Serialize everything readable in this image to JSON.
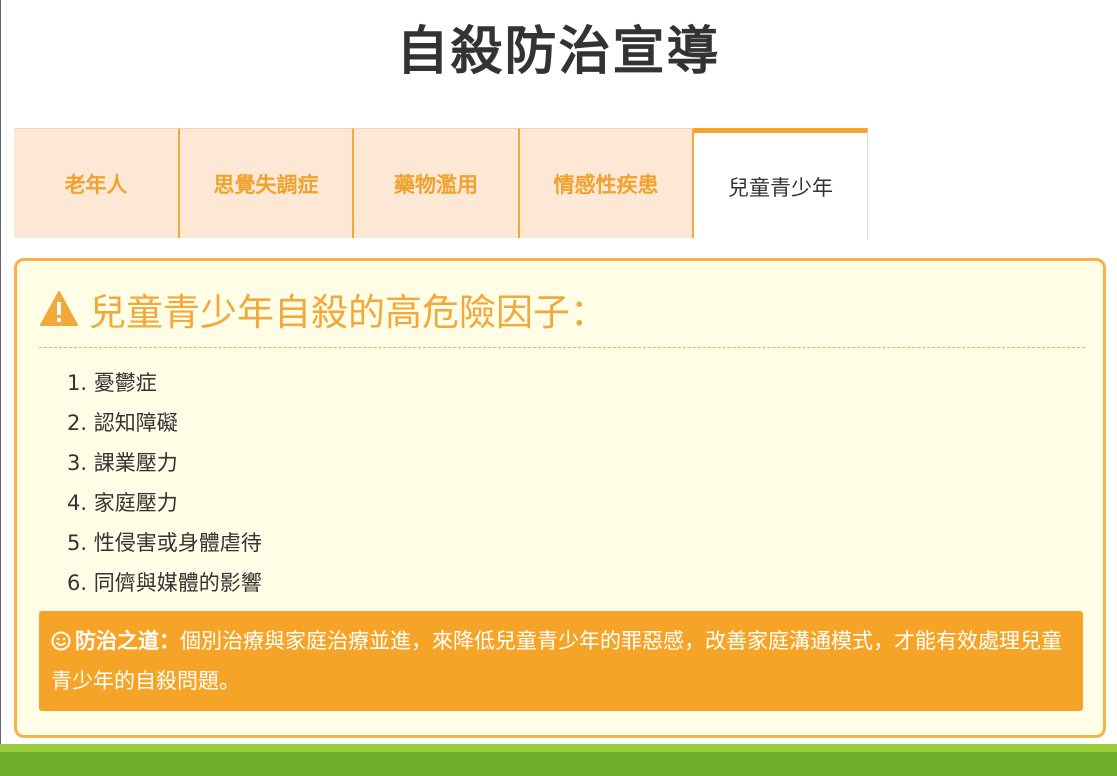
{
  "page": {
    "title": "自殺防治宣導"
  },
  "tabs": [
    {
      "label": "老年人",
      "active": false
    },
    {
      "label": "思覺失調症",
      "active": false
    },
    {
      "label": "藥物濫用",
      "active": false
    },
    {
      "label": "情感性疾患",
      "active": false
    },
    {
      "label": "兒童青少年",
      "active": true
    }
  ],
  "panel": {
    "icon": "warning-triangle-icon",
    "heading": "兒童青少年自殺的高危險因子：",
    "risk_factors": [
      "1. 憂鬱症",
      "2. 認知障礙",
      "3. 課業壓力",
      "4. 家庭壓力",
      "5. 性侵害或身體虐待",
      "6. 同儕與媒體的影響"
    ],
    "tip": {
      "icon": "smile-icon",
      "label": "防治之道：",
      "text": "個別治療與家庭治療並進，來降低兒童青少年的罪惡感，改善家庭溝通模式，才能有效處理兒童青少年的自殺問題。"
    }
  },
  "colors": {
    "accent": "#f6a428",
    "tab_bg": "#fde8d5",
    "panel_bg": "#fffde6",
    "footer_light": "#9acd3a",
    "footer_dark": "#6cae2c"
  }
}
